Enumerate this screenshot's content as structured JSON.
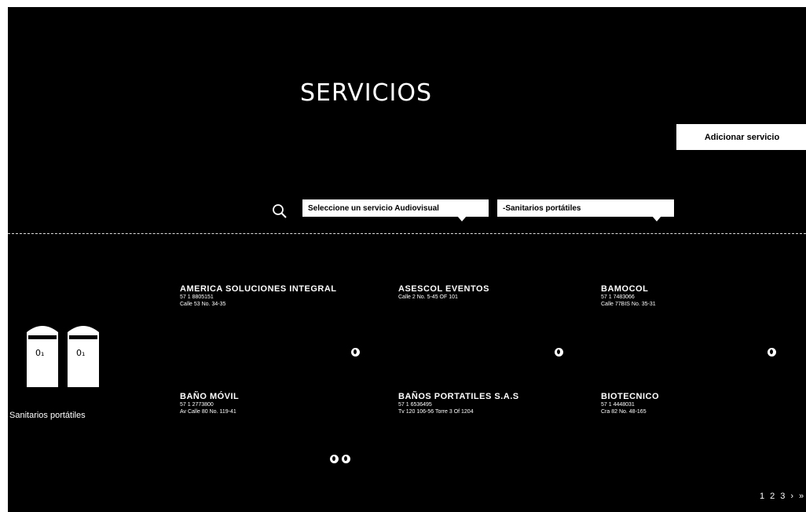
{
  "page": {
    "title": "SERVICIOS"
  },
  "toolbar": {
    "add_label": "Adicionar servicio"
  },
  "filters": {
    "service_select": "Seleccione un servicio Audiovisual",
    "category_select": "-Sanitarios portátiles"
  },
  "category": {
    "name": "Sanitarios portátiles",
    "icon": "portable-toilet-icon"
  },
  "providers": [
    {
      "name": "AMERICA SOLUCIONES INTEGRAL",
      "phone": "57 1 8805151",
      "address": "Calle 53 No. 34-35"
    },
    {
      "name": "ASESCOL EVENTOS",
      "phone": "",
      "address": "Calle 2 No. 5-45 OF 101"
    },
    {
      "name": "BAMOCOL",
      "phone": "57 1 7483066",
      "address": "Calle 77BIS No. 35-31"
    },
    {
      "name": "BAÑO MÓVIL",
      "phone": "57 1 2773800",
      "address": "Av Calle 80 No. 119-41"
    },
    {
      "name": "BAÑOS PORTATILES S.A.S",
      "phone": "57 1 6536495",
      "address": "Tv 120 106-56 Torre 3 Of 1204"
    },
    {
      "name": "BIOTECNICO",
      "phone": "57 1 4448031",
      "address": "Cra 82 No. 48-165"
    }
  ],
  "pagination": {
    "p1": "1",
    "p2": "2",
    "p3": "3",
    "next": "›",
    "last": "»"
  },
  "colors": {
    "background": "#000000",
    "foreground": "#ffffff"
  }
}
